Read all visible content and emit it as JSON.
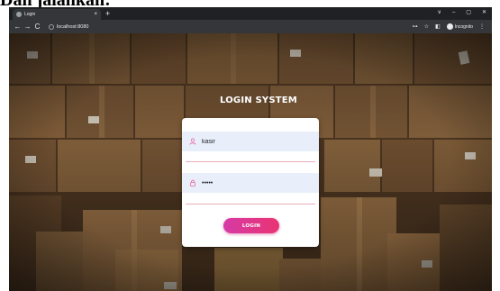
{
  "caption": "Dan jalankan:",
  "browser": {
    "tab_title": "Login",
    "tab_close": "×",
    "new_tab": "+",
    "window_controls": [
      "∨",
      "–",
      "▢",
      "✕"
    ],
    "nav": {
      "back": "←",
      "forward": "→",
      "reload": "C"
    },
    "url": "localhost:8080",
    "incognito_label": "Incognito",
    "menu": "⋮",
    "key_icon": "⊶",
    "star_icon": "☆",
    "sidebar_icon": "◧"
  },
  "page": {
    "title": "LOGIN SYSTEM",
    "username": {
      "value": "kasir",
      "icon": "user-icon"
    },
    "password": {
      "value": "•••••",
      "icon": "lock-icon"
    },
    "login_label": "LOGIN",
    "colors": {
      "accent_start": "#d63aa6",
      "accent_end": "#e93473",
      "field_bg": "#e8effb",
      "underline": "#e6aeb8"
    }
  }
}
